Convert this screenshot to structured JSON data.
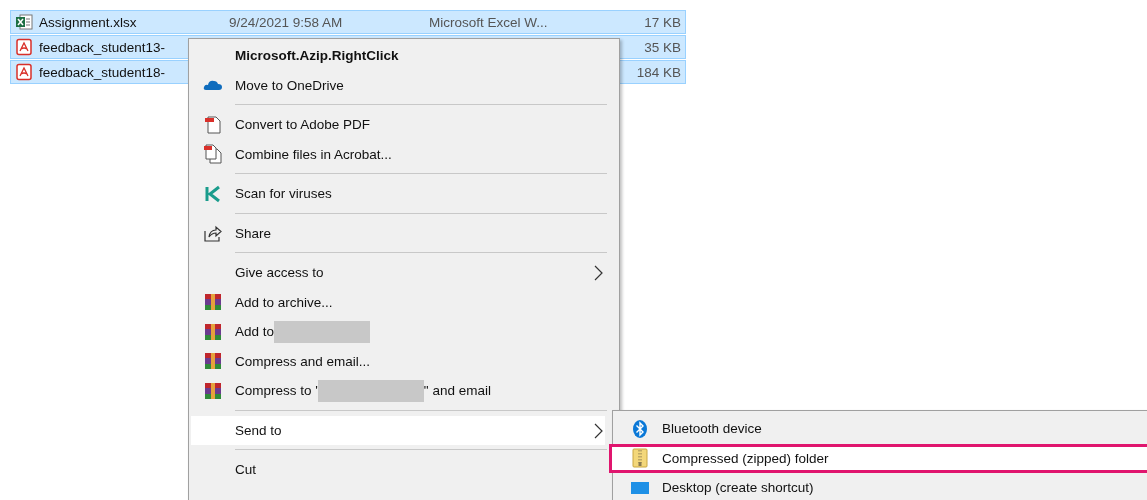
{
  "files": [
    {
      "kind": "excel",
      "name": "Assignment.xlsx",
      "date": "9/24/2021 9:58 AM",
      "type": "Microsoft Excel W...",
      "size": "17 KB",
      "selected": true
    },
    {
      "kind": "pdf",
      "name": "feedback_student13-",
      "size": "35 KB",
      "selected": true
    },
    {
      "kind": "pdf",
      "name": "feedback_student18-",
      "size": "184 KB",
      "selected": true
    }
  ],
  "context_menu": {
    "items": [
      {
        "kind": "header",
        "label": "Microsoft.Azip.RightClick",
        "selected": false
      },
      {
        "kind": "cloud",
        "label": "Move to OneDrive",
        "selected": false
      },
      {
        "kind": "separator"
      },
      {
        "kind": "pdf",
        "label": "Convert to Adobe PDF",
        "selected": false
      },
      {
        "kind": "pdf-multi",
        "label": "Combine files in Acrobat...",
        "selected": false
      },
      {
        "kind": "separator"
      },
      {
        "kind": "antivirus",
        "label": "Scan for viruses",
        "selected": false
      },
      {
        "kind": "separator"
      },
      {
        "kind": "share",
        "label": "Share",
        "selected": false
      },
      {
        "kind": "separator"
      },
      {
        "kind": "submenu",
        "label": "Give access to",
        "selected": false
      },
      {
        "kind": "archive",
        "label": "Add to archive...",
        "selected": false
      },
      {
        "kind": "archive-redacted",
        "label": "Add to",
        "selected": false
      },
      {
        "kind": "archive",
        "label": "Compress and email...",
        "selected": false
      },
      {
        "kind": "archive-redacted",
        "label": "Compress to '",
        "after": "\" and email",
        "selected": false
      },
      {
        "kind": "separator"
      },
      {
        "kind": "submenu",
        "label": "Send to",
        "selected": true
      },
      {
        "kind": "separator"
      },
      {
        "kind": "plain",
        "label": "Cut",
        "selected": false
      }
    ]
  },
  "send_to_menu": {
    "items": [
      {
        "kind": "bluetooth",
        "label": "Bluetooth device",
        "selected": false
      },
      {
        "kind": "zip",
        "label": "Compressed (zipped) folder",
        "selected": true
      },
      {
        "kind": "desktop",
        "label": "Desktop (create shortcut)",
        "selected": false
      }
    ]
  }
}
